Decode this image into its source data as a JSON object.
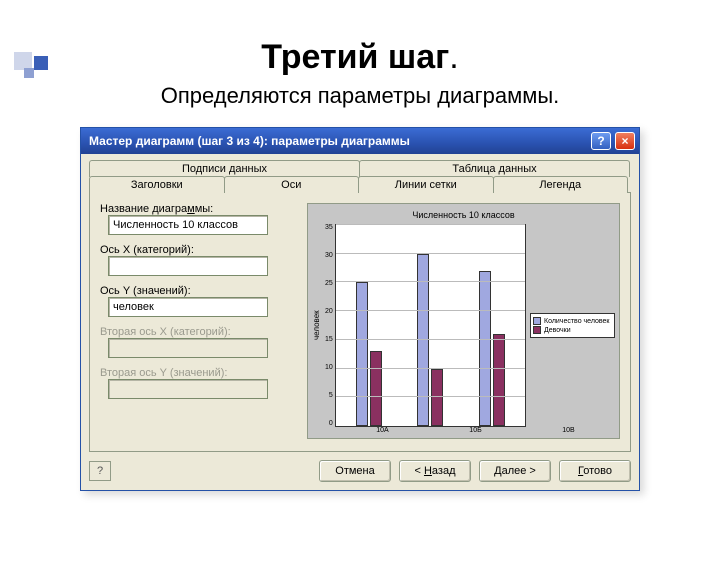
{
  "slide": {
    "title": "Третий шаг",
    "title_dot": ".",
    "subtitle": "Определяются параметры диаграммы."
  },
  "window": {
    "title": "Мастер диаграмм (шаг 3 из 4): параметры диаграммы",
    "help_glyph": "?",
    "close_glyph": "×"
  },
  "tabs": {
    "back": [
      "Подписи данных",
      "Таблица данных"
    ],
    "front": [
      "Заголовки",
      "Оси",
      "Линии сетки",
      "Легенда"
    ],
    "active_index": 0
  },
  "fields": {
    "chart_title_label_pre": "Название диагра",
    "chart_title_label_ul": "м",
    "chart_title_label_post": "мы:",
    "chart_title_value": "Численность 10 классов",
    "x_label": "Ось X (категорий):",
    "x_value": "",
    "y_label": "Ось Y (значений):",
    "y_value": "человек",
    "x2_label": "Вторая ось X (категорий):",
    "y2_label": "Вторая ось Y (значений):"
  },
  "buttons": {
    "cancel": "Отмена",
    "back_pre": "< ",
    "back_ul": "Н",
    "back_post": "азад",
    "next_pre": "",
    "next_ul": "Д",
    "next_post": "алее >",
    "finish_pre": "",
    "finish_ul": "Г",
    "finish_post": "отово",
    "mini_help": "?"
  },
  "chart_data": {
    "type": "bar",
    "title": "Численность 10 классов",
    "ylabel": "человек",
    "xlabel": "",
    "categories": [
      "10А",
      "10Б",
      "10В"
    ],
    "series": [
      {
        "name": "Количество человек",
        "values": [
          25,
          30,
          27
        ],
        "color": "#a0a8e0"
      },
      {
        "name": "Девочки",
        "values": [
          13,
          10,
          16
        ],
        "color": "#8a3060"
      }
    ],
    "ylim": [
      0,
      35
    ],
    "yticks": [
      0,
      5,
      10,
      15,
      20,
      25,
      30,
      35
    ],
    "legend_position": "right",
    "grid": true
  }
}
